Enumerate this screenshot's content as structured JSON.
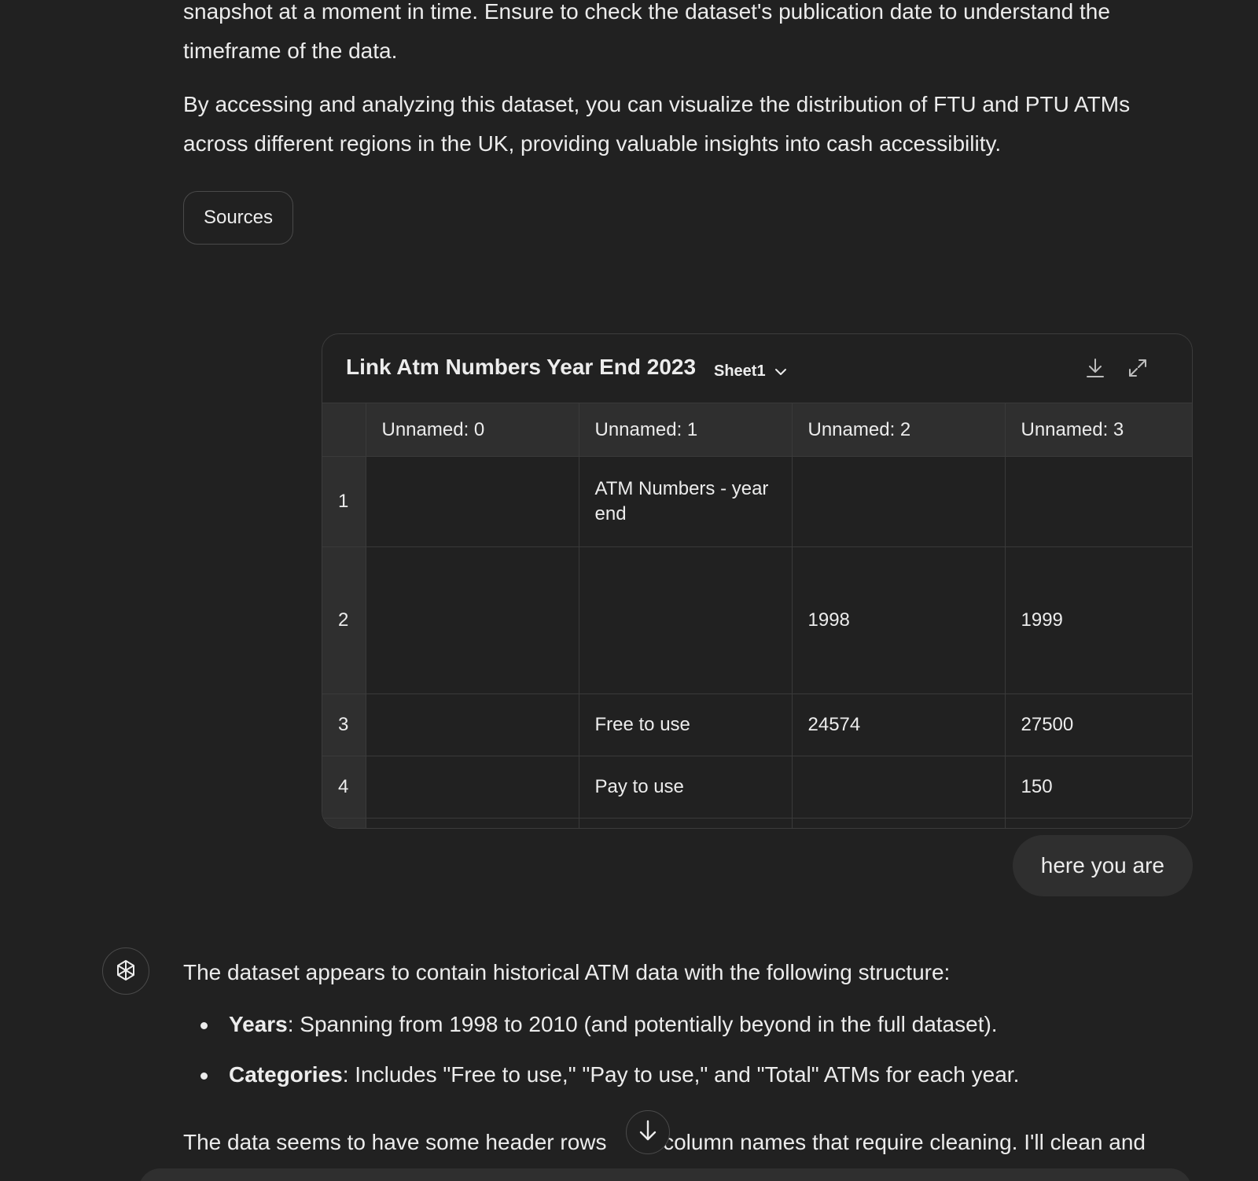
{
  "conversation": {
    "prev_para_1": "snapshot at a moment in time. Ensure to check the dataset's publication date to understand the timeframe of the data.",
    "prev_para_2": "By accessing and analyzing this dataset, you can visualize the distribution of FTU and PTU ATMs across different regions in the UK, providing valuable insights into cash accessibility.",
    "sources_label": "Sources"
  },
  "sheet": {
    "title": "Link Atm Numbers Year End 2023",
    "tab_label": "Sheet1",
    "icons": {
      "tab_dropdown": "chevron-down-icon",
      "download": "download-icon",
      "expand": "expand-icon"
    },
    "columns": [
      "Unnamed: 0",
      "Unnamed: 1",
      "Unnamed: 2",
      "Unnamed: 3"
    ],
    "rows": [
      {
        "index": "1",
        "cells": [
          "",
          "ATM Numbers - year end",
          "",
          ""
        ]
      },
      {
        "index": "2",
        "cells": [
          "",
          "",
          "1998",
          "1999"
        ]
      },
      {
        "index": "3",
        "cells": [
          "",
          "Free to use",
          "24574",
          "27500"
        ]
      },
      {
        "index": "4",
        "cells": [
          "",
          "Pay to use",
          "",
          "150"
        ]
      }
    ]
  },
  "user_message": "here you are",
  "assistant": {
    "avatar_icon": "openai-logo-icon",
    "intro": "The dataset appears to contain historical ATM data with the following structure:",
    "bullets": [
      {
        "label": "Years",
        "text": ": Spanning from 1998 to 2010 (and potentially beyond in the full dataset)."
      },
      {
        "label": "Categories",
        "text": ": Includes \"Free to use,\" \"Pay to use,\" and \"Total\" ATMs for each year."
      }
    ],
    "tail_before": "The data seems to have some header rows ",
    "tail_after": " column names that require cleaning. I'll clean and"
  },
  "scroll_button_icon": "arrow-down-icon",
  "colors": {
    "background": "#212121",
    "surface": "#2f2f2f",
    "border": "#3a3a3a",
    "text": "#ececec"
  }
}
